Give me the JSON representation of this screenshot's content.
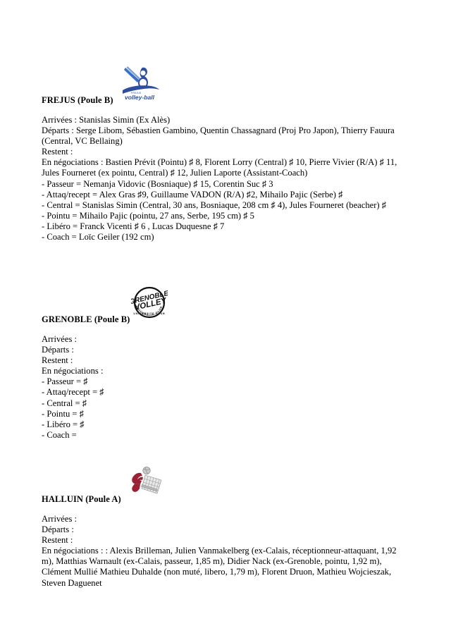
{
  "document": {
    "type": "volleyball-club-transfer-notes",
    "sections": [
      {
        "id": "frejus",
        "club": "FREJUS (Poule B)",
        "logo": {
          "name": "frejus-volley-ball-logo",
          "text": "volley-ball",
          "subtext": "FREJUS",
          "colors": {
            "primary": "#2d4f9e",
            "accent": "#3b6fc4",
            "bg": "#ffffff"
          }
        },
        "lines": [
          "Arrivées :  Stanislas Simin (Ex Alès)",
          "Départs :  Serge Libom, Sébastien Gambino, Quentin Chassagnard (Proj Pro Japon), Thierry Fauura (Central, VC Bellaing)",
          "Restent :",
          "En négociations :  Bastien Prévit (Pointu) ♯ 8, Florent Lorry (Central) ♯ 10, Pierre Vivier (R/A) ♯ 11, Jules Fourneret (ex pointu, Central) ♯ 12,   Julien Laporte (Assistant-Coach)",
          "- Passeur =  Nemanja Vidovic (Bosniaque) ♯ 15, Corentin Suc ♯ 3",
          "- Attaq/recept =  Alex Gras ♯9, Guillaume VADON (R/A) ♯2, Mihailo Pajic (Serbe) ♯",
          "- Central =  Stanislas Simin (Central, 30 ans,  Bosniaque, 208 cm ♯ 4),  Jules Fourneret  (beacher) ♯",
          "- Pointu =  Mihailo Pajic (pointu, 27 ans, Serbe, 195 cm) ♯ 5",
          "- Libéro =   Franck Vicenti ♯ 6 , Lucas Duquesne ♯ 7",
          "- Coach = Loïc Geiler (192 cm)"
        ]
      },
      {
        "id": "grenoble",
        "club": "GRENOBLE (Poule B)",
        "logo": {
          "name": "grenoble-volley-logo",
          "text": "GRENOBLE VOLLEY",
          "subtext": "UNIVERSITE CLUB",
          "colors": {
            "primary": "#111111",
            "accent": "#000000",
            "bg": "#ffffff"
          }
        },
        "lines": [
          "Arrivées :",
          "Départs :",
          "Restent :",
          "En négociations :",
          "- Passeur =  ♯",
          "- Attaq/recept =  ♯",
          "- Central =  ♯",
          "- Pointu =  ♯",
          "- Libéro =  ♯",
          "- Coach ="
        ]
      },
      {
        "id": "halluin",
        "club": "HALLUIN (Poule A)",
        "logo": {
          "name": "halluin-volley-logo",
          "text": "",
          "subtext": "",
          "colors": {
            "primary": "#9b2033",
            "accent": "#8a8a8a",
            "bg": "#ffffff"
          }
        },
        "lines": [
          "Arrivées :",
          "Départs :",
          "Restent :",
          "En négociations :   : Alexis Brilleman, Julien Vanmakelberg (ex-Calais, réceptionneur-attaquant, 1,92 m), Matthias Warnault (ex-Calais, passeur, 1,85 m), Didier Nack (ex-Grenoble, pointu, 1,92 m), Clément Mullié Mathieu Duhalde (non muté, libero, 1,79 m), Florent Druon, Mathieu Wojcieszak, Steven Daguenet"
        ]
      }
    ]
  }
}
